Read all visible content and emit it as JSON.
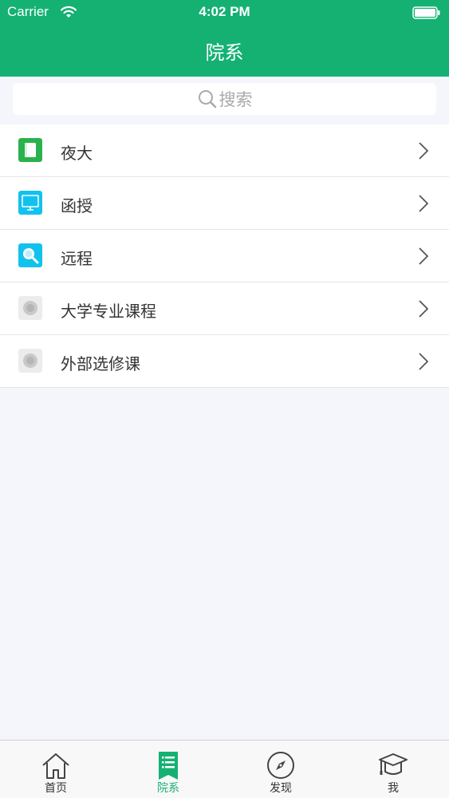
{
  "status_bar": {
    "carrier": "Carrier",
    "time": "4:02 PM"
  },
  "nav": {
    "title": "院系"
  },
  "search": {
    "placeholder": "搜索"
  },
  "items": [
    {
      "label": "夜大",
      "icon": "book-icon",
      "color": "#2bb24c"
    },
    {
      "label": "函授",
      "icon": "tv-icon",
      "color": "#12c2ee"
    },
    {
      "label": "远程",
      "icon": "magnifier-icon",
      "color": "#12c2ee"
    },
    {
      "label": "大学专业课程",
      "icon": "placeholder-image-icon",
      "color": "#e3e3e3"
    },
    {
      "label": "外部选修课",
      "icon": "placeholder-image-icon",
      "color": "#e3e3e3"
    }
  ],
  "tabbar": {
    "tabs": [
      {
        "label": "首页",
        "icon": "home-icon"
      },
      {
        "label": "院系",
        "icon": "list-icon",
        "active": true
      },
      {
        "label": "发现",
        "icon": "compass-icon"
      },
      {
        "label": "我",
        "icon": "graduation-cap-icon"
      }
    ]
  },
  "colors": {
    "brand": "#14b173",
    "background": "#f4f6fb"
  }
}
